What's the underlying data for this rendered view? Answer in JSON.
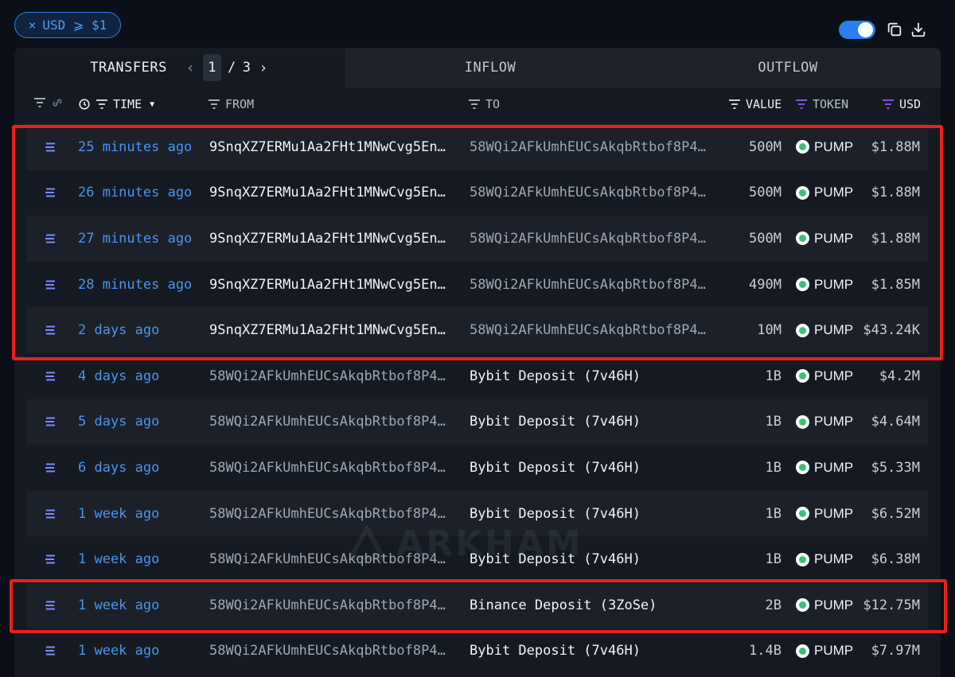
{
  "filter_chip": {
    "close": "×",
    "label": "USD ⩾ $1"
  },
  "tabs": {
    "transfers": "TRANSFERS",
    "page_current": "1",
    "page_sep": "/",
    "page_total": "3",
    "inflow": "INFLOW",
    "outflow": "OUTFLOW"
  },
  "columns": {
    "time": "TIME",
    "from": "FROM",
    "to": "TO",
    "value": "VALUE",
    "token": "TOKEN",
    "usd": "USD"
  },
  "watermark": "ARKHAM",
  "rows": [
    {
      "time": "25 minutes ago",
      "from": "9SnqXZ7ERMu1Aa2FHt1MNwCvg5En…",
      "to": "58WQi2AFkUmhEUCsAkqbRtbof8P4…",
      "value": "500M",
      "token": "PUMP",
      "usd": "$1.88M"
    },
    {
      "time": "26 minutes ago",
      "from": "9SnqXZ7ERMu1Aa2FHt1MNwCvg5En…",
      "to": "58WQi2AFkUmhEUCsAkqbRtbof8P4…",
      "value": "500M",
      "token": "PUMP",
      "usd": "$1.88M"
    },
    {
      "time": "27 minutes ago",
      "from": "9SnqXZ7ERMu1Aa2FHt1MNwCvg5En…",
      "to": "58WQi2AFkUmhEUCsAkqbRtbof8P4…",
      "value": "500M",
      "token": "PUMP",
      "usd": "$1.88M"
    },
    {
      "time": "28 minutes ago",
      "from": "9SnqXZ7ERMu1Aa2FHt1MNwCvg5En…",
      "to": "58WQi2AFkUmhEUCsAkqbRtbof8P4…",
      "value": "490M",
      "token": "PUMP",
      "usd": "$1.85M"
    },
    {
      "time": "2 days ago",
      "from": "9SnqXZ7ERMu1Aa2FHt1MNwCvg5En…",
      "to": "58WQi2AFkUmhEUCsAkqbRtbof8P4…",
      "value": "10M",
      "token": "PUMP",
      "usd": "$43.24K"
    },
    {
      "time": "4 days ago",
      "from": "58WQi2AFkUmhEUCsAkqbRtbof8P4…",
      "to": "Bybit Deposit (7v46H)",
      "value": "1B",
      "token": "PUMP",
      "usd": "$4.2M"
    },
    {
      "time": "5 days ago",
      "from": "58WQi2AFkUmhEUCsAkqbRtbof8P4…",
      "to": "Bybit Deposit (7v46H)",
      "value": "1B",
      "token": "PUMP",
      "usd": "$4.64M"
    },
    {
      "time": "6 days ago",
      "from": "58WQi2AFkUmhEUCsAkqbRtbof8P4…",
      "to": "Bybit Deposit (7v46H)",
      "value": "1B",
      "token": "PUMP",
      "usd": "$5.33M"
    },
    {
      "time": "1 week ago",
      "from": "58WQi2AFkUmhEUCsAkqbRtbof8P4…",
      "to": "Bybit Deposit (7v46H)",
      "value": "1B",
      "token": "PUMP",
      "usd": "$6.52M"
    },
    {
      "time": "1 week ago",
      "from": "58WQi2AFkUmhEUCsAkqbRtbof8P4…",
      "to": "Bybit Deposit (7v46H)",
      "value": "1B",
      "token": "PUMP",
      "usd": "$6.38M"
    },
    {
      "time": "1 week ago",
      "from": "58WQi2AFkUmhEUCsAkqbRtbof8P4…",
      "to": "Binance Deposit (3ZoSe)",
      "value": "2B",
      "token": "PUMP",
      "usd": "$12.75M"
    },
    {
      "time": "1 week ago",
      "from": "58WQi2AFkUmhEUCsAkqbRtbof8P4…",
      "to": "Bybit Deposit (7v46H)",
      "value": "1.4B",
      "token": "PUMP",
      "usd": "$7.97M"
    }
  ],
  "colors": {
    "accent": "#2a7ef0",
    "time_link": "#4a95ee",
    "highlight": "#e8221b",
    "token_green": "#3bc07a"
  }
}
